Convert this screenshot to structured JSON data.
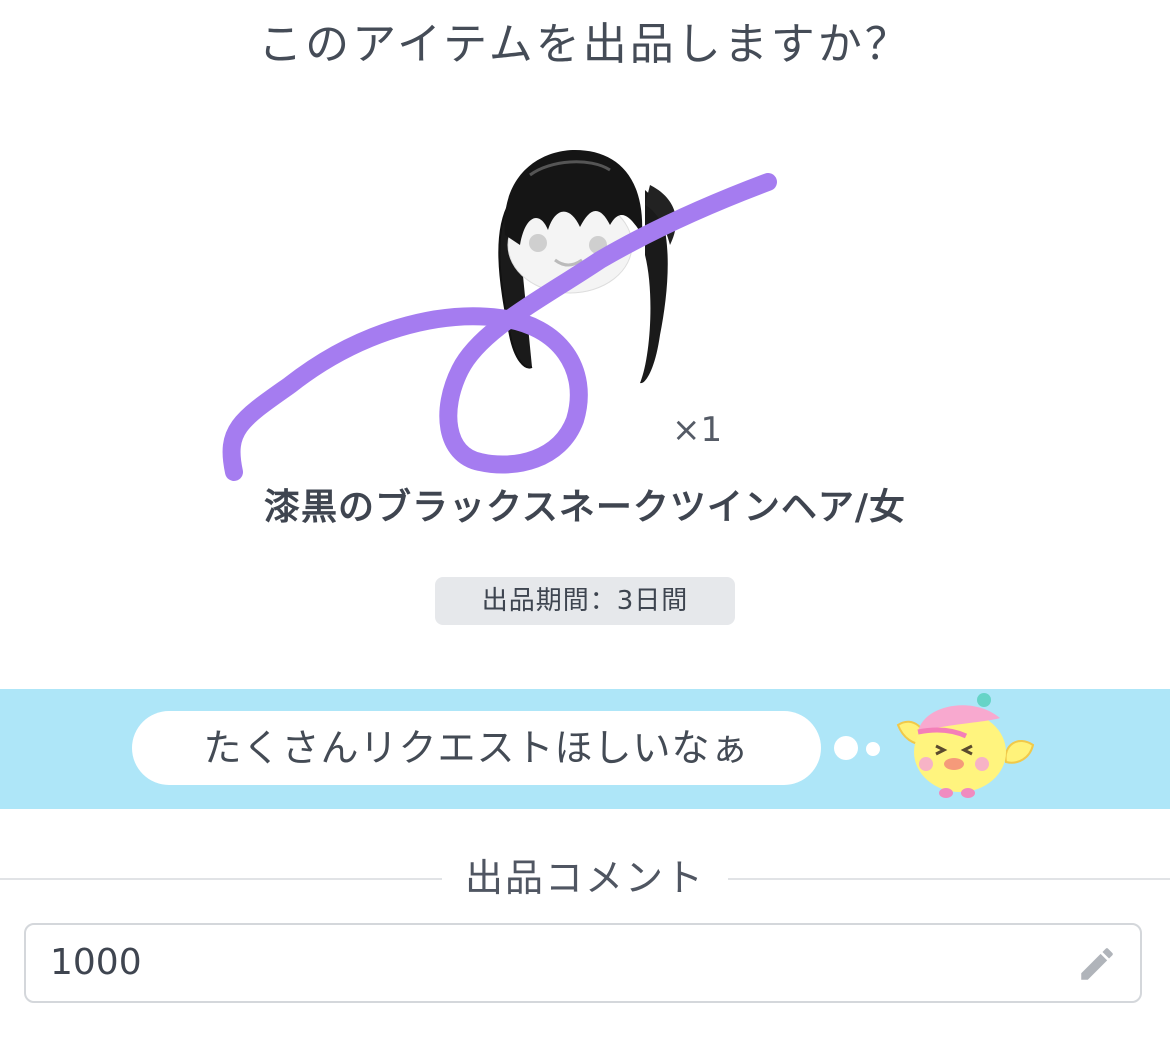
{
  "dialog": {
    "title": "このアイテムを出品しますか？"
  },
  "item": {
    "quantity": "×1",
    "name": "漆黒のブラックスネークツインヘア/女",
    "listing_period": "出品期間：3日間"
  },
  "banner": {
    "message": "たくさんリクエストほしいなぁ"
  },
  "comment_section": {
    "label": "出品コメント",
    "value": "1000"
  },
  "icons": {
    "edit": "pencil-icon"
  },
  "colors": {
    "banner_bg": "#aee6f8",
    "scribble": "#a57cf0",
    "period_badge_bg": "#e6e8eb"
  }
}
